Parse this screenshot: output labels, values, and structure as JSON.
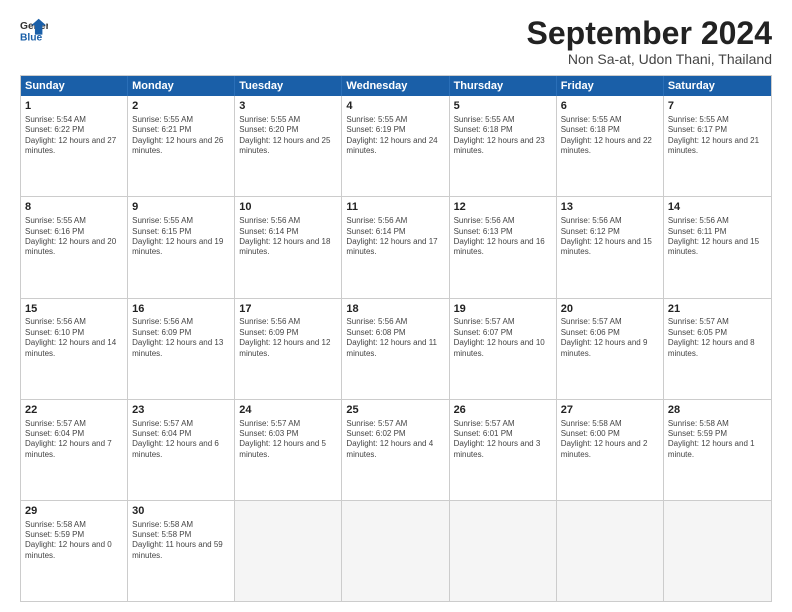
{
  "header": {
    "logo_line1": "General",
    "logo_line2": "Blue",
    "month_title": "September 2024",
    "location": "Non Sa-at, Udon Thani, Thailand"
  },
  "weekdays": [
    "Sunday",
    "Monday",
    "Tuesday",
    "Wednesday",
    "Thursday",
    "Friday",
    "Saturday"
  ],
  "rows": [
    [
      {
        "day": "",
        "empty": true
      },
      {
        "day": "2",
        "sr": "5:55 AM",
        "ss": "6:21 PM",
        "dl": "Daylight: 12 hours and 26 minutes."
      },
      {
        "day": "3",
        "sr": "5:55 AM",
        "ss": "6:20 PM",
        "dl": "Daylight: 12 hours and 25 minutes."
      },
      {
        "day": "4",
        "sr": "5:55 AM",
        "ss": "6:19 PM",
        "dl": "Daylight: 12 hours and 24 minutes."
      },
      {
        "day": "5",
        "sr": "5:55 AM",
        "ss": "6:18 PM",
        "dl": "Daylight: 12 hours and 23 minutes."
      },
      {
        "day": "6",
        "sr": "5:55 AM",
        "ss": "6:18 PM",
        "dl": "Daylight: 12 hours and 22 minutes."
      },
      {
        "day": "7",
        "sr": "5:55 AM",
        "ss": "6:17 PM",
        "dl": "Daylight: 12 hours and 21 minutes."
      }
    ],
    [
      {
        "day": "1",
        "sr": "5:54 AM",
        "ss": "6:22 PM",
        "dl": "Daylight: 12 hours and 27 minutes."
      },
      {
        "day": "",
        "empty": true
      },
      {
        "day": "",
        "empty": true
      },
      {
        "day": "",
        "empty": true
      },
      {
        "day": "",
        "empty": true
      },
      {
        "day": "",
        "empty": true
      },
      {
        "day": "",
        "empty": true
      }
    ],
    [
      {
        "day": "8",
        "sr": "5:55 AM",
        "ss": "6:16 PM",
        "dl": "Daylight: 12 hours and 20 minutes."
      },
      {
        "day": "9",
        "sr": "5:55 AM",
        "ss": "6:15 PM",
        "dl": "Daylight: 12 hours and 19 minutes."
      },
      {
        "day": "10",
        "sr": "5:56 AM",
        "ss": "6:14 PM",
        "dl": "Daylight: 12 hours and 18 minutes."
      },
      {
        "day": "11",
        "sr": "5:56 AM",
        "ss": "6:14 PM",
        "dl": "Daylight: 12 hours and 17 minutes."
      },
      {
        "day": "12",
        "sr": "5:56 AM",
        "ss": "6:13 PM",
        "dl": "Daylight: 12 hours and 16 minutes."
      },
      {
        "day": "13",
        "sr": "5:56 AM",
        "ss": "6:12 PM",
        "dl": "Daylight: 12 hours and 15 minutes."
      },
      {
        "day": "14",
        "sr": "5:56 AM",
        "ss": "6:11 PM",
        "dl": "Daylight: 12 hours and 15 minutes."
      }
    ],
    [
      {
        "day": "15",
        "sr": "5:56 AM",
        "ss": "6:10 PM",
        "dl": "Daylight: 12 hours and 14 minutes."
      },
      {
        "day": "16",
        "sr": "5:56 AM",
        "ss": "6:09 PM",
        "dl": "Daylight: 12 hours and 13 minutes."
      },
      {
        "day": "17",
        "sr": "5:56 AM",
        "ss": "6:09 PM",
        "dl": "Daylight: 12 hours and 12 minutes."
      },
      {
        "day": "18",
        "sr": "5:56 AM",
        "ss": "6:08 PM",
        "dl": "Daylight: 12 hours and 11 minutes."
      },
      {
        "day": "19",
        "sr": "5:57 AM",
        "ss": "6:07 PM",
        "dl": "Daylight: 12 hours and 10 minutes."
      },
      {
        "day": "20",
        "sr": "5:57 AM",
        "ss": "6:06 PM",
        "dl": "Daylight: 12 hours and 9 minutes."
      },
      {
        "day": "21",
        "sr": "5:57 AM",
        "ss": "6:05 PM",
        "dl": "Daylight: 12 hours and 8 minutes."
      }
    ],
    [
      {
        "day": "22",
        "sr": "5:57 AM",
        "ss": "6:04 PM",
        "dl": "Daylight: 12 hours and 7 minutes."
      },
      {
        "day": "23",
        "sr": "5:57 AM",
        "ss": "6:04 PM",
        "dl": "Daylight: 12 hours and 6 minutes."
      },
      {
        "day": "24",
        "sr": "5:57 AM",
        "ss": "6:03 PM",
        "dl": "Daylight: 12 hours and 5 minutes."
      },
      {
        "day": "25",
        "sr": "5:57 AM",
        "ss": "6:02 PM",
        "dl": "Daylight: 12 hours and 4 minutes."
      },
      {
        "day": "26",
        "sr": "5:57 AM",
        "ss": "6:01 PM",
        "dl": "Daylight: 12 hours and 3 minutes."
      },
      {
        "day": "27",
        "sr": "5:58 AM",
        "ss": "6:00 PM",
        "dl": "Daylight: 12 hours and 2 minutes."
      },
      {
        "day": "28",
        "sr": "5:58 AM",
        "ss": "5:59 PM",
        "dl": "Daylight: 12 hours and 1 minute."
      }
    ],
    [
      {
        "day": "29",
        "sr": "5:58 AM",
        "ss": "5:59 PM",
        "dl": "Daylight: 12 hours and 0 minutes."
      },
      {
        "day": "30",
        "sr": "5:58 AM",
        "ss": "5:58 PM",
        "dl": "Daylight: 11 hours and 59 minutes."
      },
      {
        "day": "",
        "empty": true
      },
      {
        "day": "",
        "empty": true
      },
      {
        "day": "",
        "empty": true
      },
      {
        "day": "",
        "empty": true
      },
      {
        "day": "",
        "empty": true
      }
    ]
  ]
}
